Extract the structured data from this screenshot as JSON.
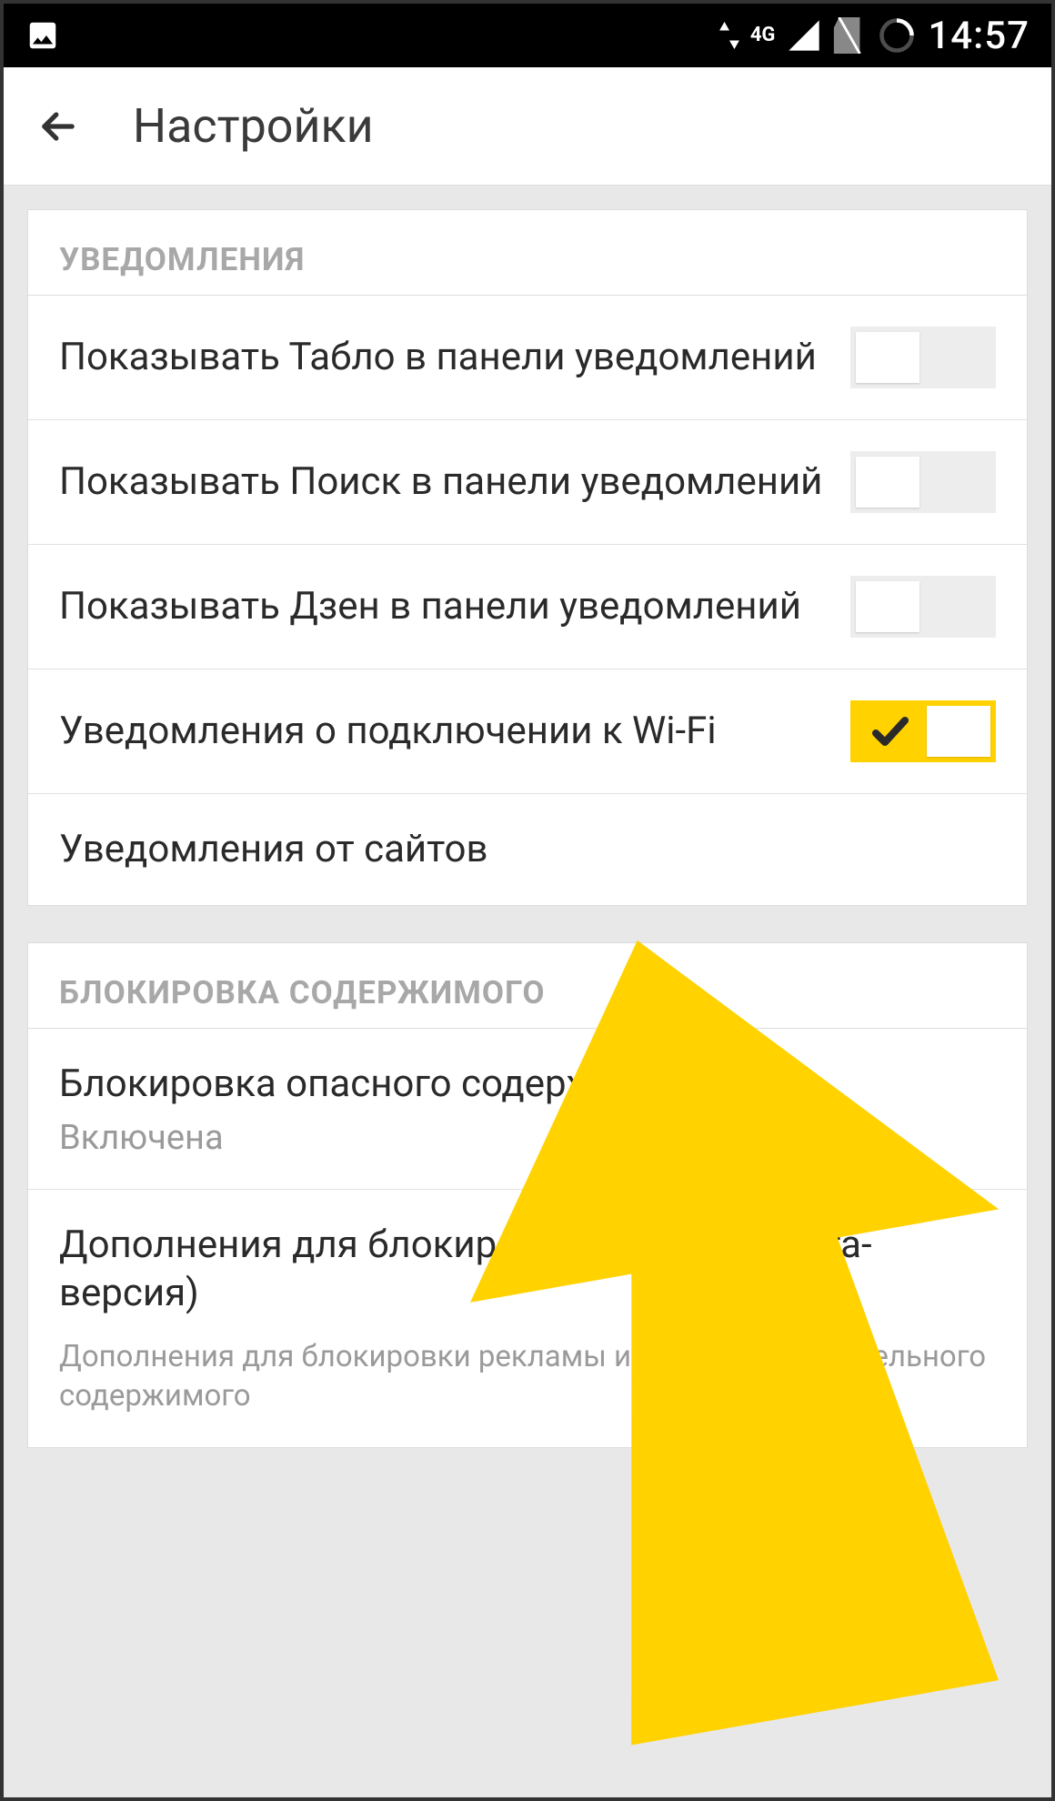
{
  "statusBar": {
    "network": "4G",
    "time": "14:57"
  },
  "appBar": {
    "title": "Настройки"
  },
  "sections": {
    "notifications": {
      "header": "УВЕДОМЛЕНИЯ",
      "items": [
        {
          "label": "Показывать Табло в панели уведомлений",
          "state": "off"
        },
        {
          "label": "Показывать Поиск в панели уведомлений",
          "state": "off"
        },
        {
          "label": "Показывать Дзен в панели уведомлений",
          "state": "off"
        },
        {
          "label": "Уведомления о подключении к Wi-Fi",
          "state": "on"
        },
        {
          "label": "Уведомления от сайтов"
        }
      ]
    },
    "contentBlock": {
      "header": "БЛОКИРОВКА СОДЕРЖИМОГО",
      "items": [
        {
          "label": "Блокировка опасного содержимого",
          "sub": "Включена"
        },
        {
          "label": "Дополнения для блокировки рекламы (Бета-версия)",
          "desc": "Дополнения для блокировки рекламы и другого нежелательного содержимого"
        }
      ]
    }
  },
  "overlay": {
    "arrowColor": "#ffd200"
  }
}
